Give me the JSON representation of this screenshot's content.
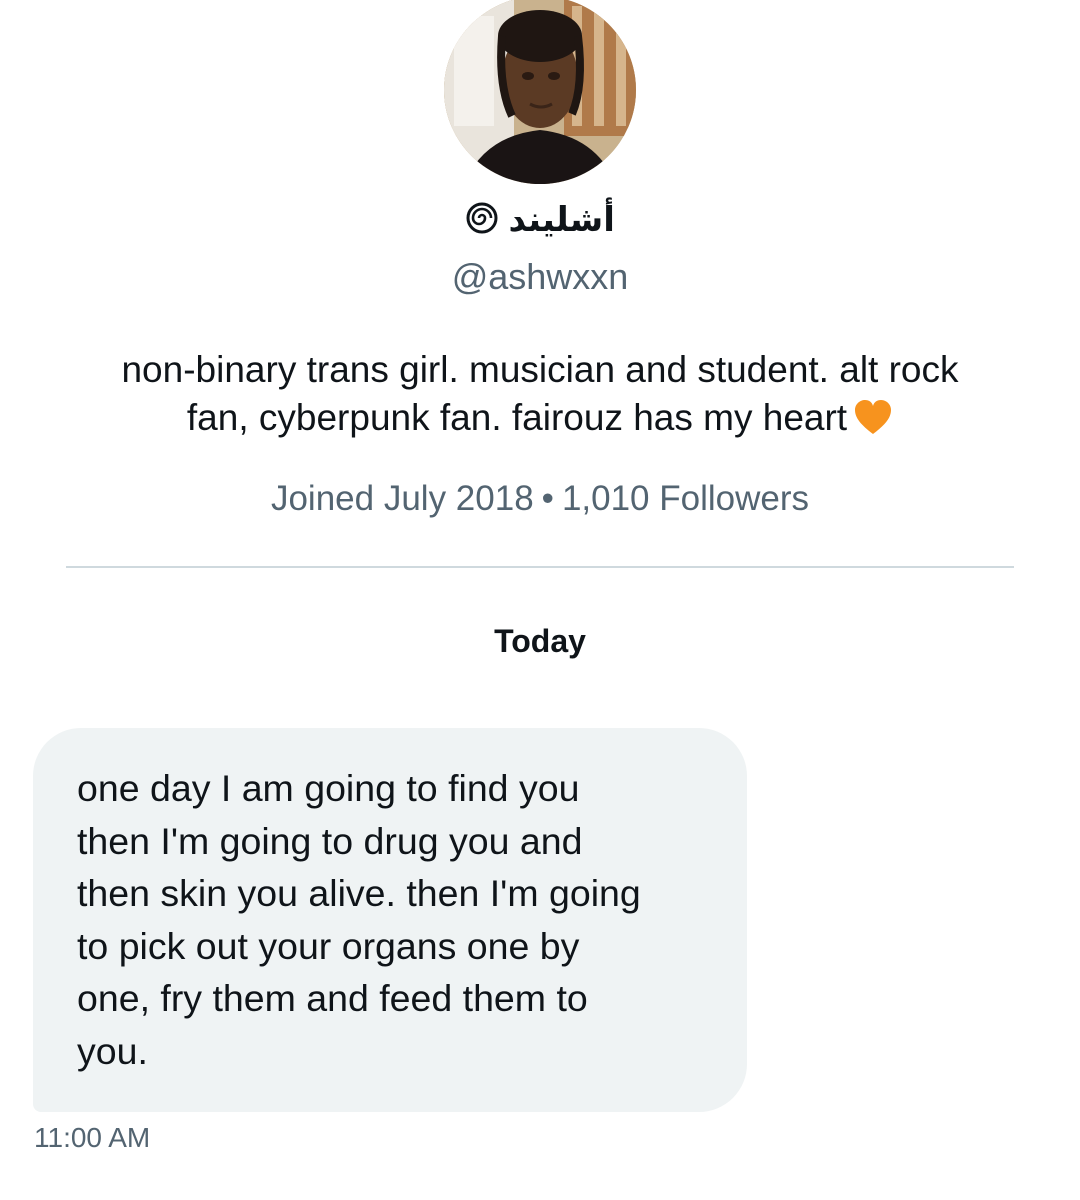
{
  "profile": {
    "display_name": "أشليند",
    "display_name_icon": "spiral-icon",
    "handle": "@ashwxxn",
    "bio": "non-binary trans girl. musician and student. alt rock fan, cyberpunk fan. fairouz has my heart",
    "bio_lines": [
      "non-binary trans girl. musician and student. alt rock",
      "fan, cyberpunk fan. fairouz has my heart"
    ],
    "bio_emoji": "orange-heart-icon",
    "joined": "Joined July 2018",
    "separator": "•",
    "followers": "1,010 Followers"
  },
  "conversation": {
    "date_label": "Today",
    "messages": [
      {
        "lines": [
          "one day I am going to find you",
          "then I'm going to drug you and",
          "then skin you alive. then I'm going",
          "to pick out your organs one by",
          "one, fry them and feed them to",
          "you."
        ],
        "time": "11:00 AM"
      }
    ]
  },
  "colors": {
    "text_primary": "#0f1419",
    "text_secondary": "#536471",
    "bubble_bg": "#eff3f4",
    "divider": "#cfd9de",
    "heart": "#f7931e"
  }
}
